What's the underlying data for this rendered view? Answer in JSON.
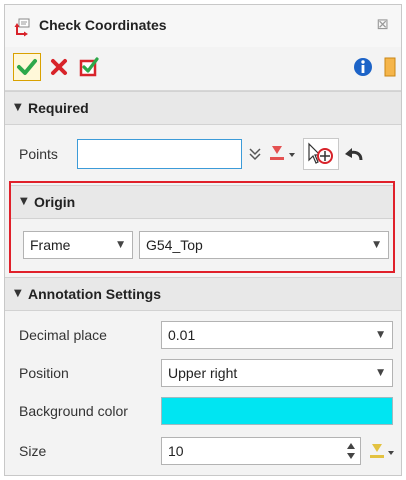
{
  "window": {
    "title": "Check Coordinates"
  },
  "actions": {
    "ok": "ok",
    "cancel": "cancel",
    "apply": "apply",
    "info": "info"
  },
  "required": {
    "header": "Required",
    "points_label": "Points",
    "points_value": ""
  },
  "origin": {
    "header": "Origin",
    "type_value": "Frame",
    "frame_value": "G54_Top"
  },
  "annotation": {
    "header": "Annotation Settings",
    "decimal_label": "Decimal place",
    "decimal_value": "0.01",
    "position_label": "Position",
    "position_value": "Upper right",
    "bgcolor_label": "Background color",
    "bgcolor_value": "#00e5f2",
    "size_label": "Size",
    "size_value": "10"
  },
  "icons": {
    "title": "coordinate-frame-icon",
    "close": "close-icon",
    "ok": "checkmark-icon",
    "cancel": "x-icon",
    "apply": "apply-check-icon",
    "info": "info-icon",
    "expand": "double-chevron-icon",
    "pick": "pick-point-icon",
    "filter": "filter-select-icon",
    "undo": "undo-icon",
    "size_pick": "size-pick-icon"
  },
  "colors": {
    "accent": "#3c9bd8",
    "highlight": "#e0202a",
    "ok": "#2da84a",
    "cancel": "#d8232a",
    "info": "#1c63c7"
  }
}
